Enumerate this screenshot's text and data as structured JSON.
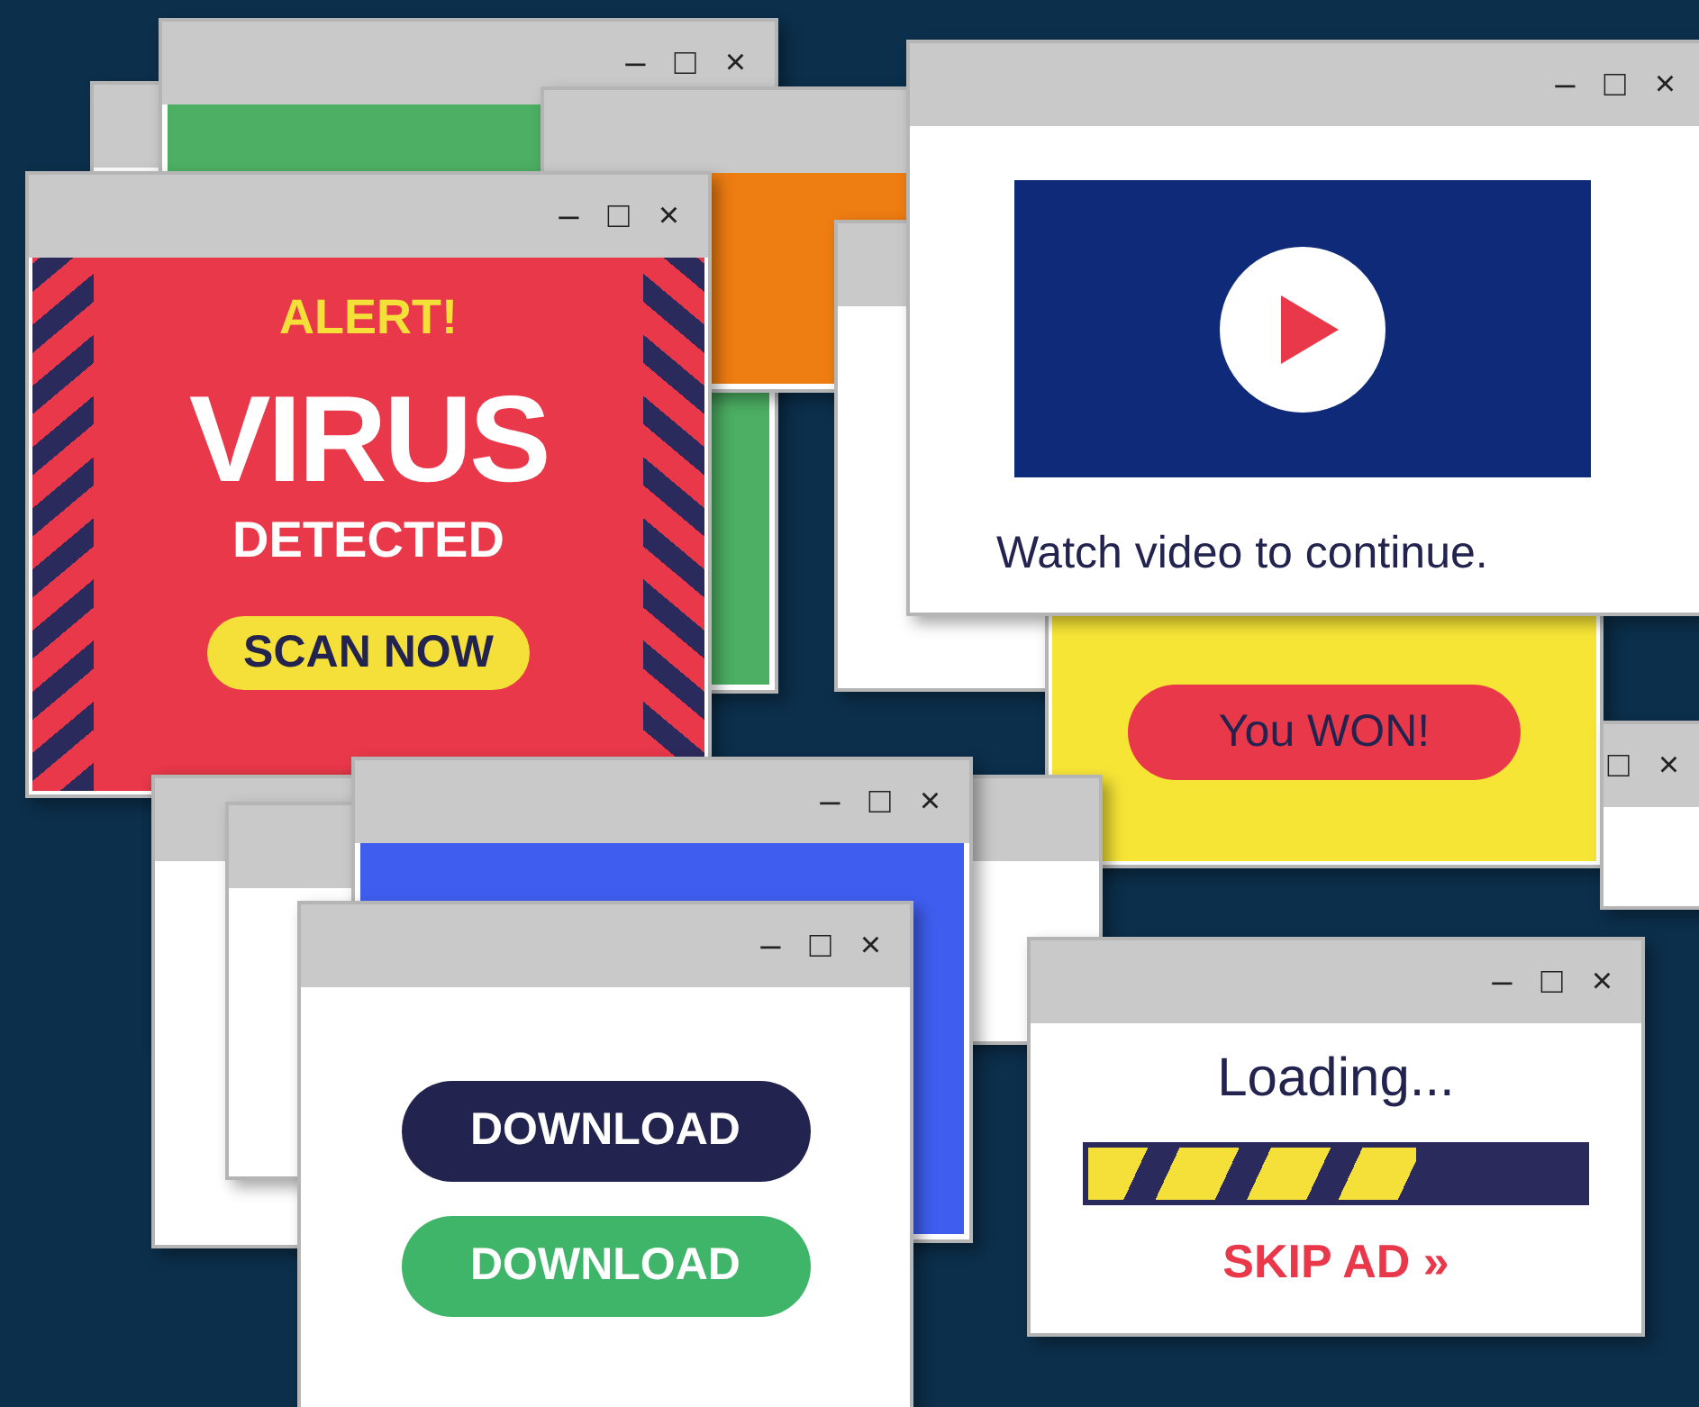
{
  "windows": [
    {
      "kind": "blank"
    },
    {
      "kind": "blank",
      "color": "#4caf63",
      "controls": [
        "–",
        "□",
        "×"
      ]
    },
    {
      "kind": "blank",
      "color": "#ee7d12"
    },
    {
      "kind": "blank"
    },
    {
      "kind": "alert",
      "heading": "ALERT!",
      "title": "VIRUS",
      "subtitle": "DETECTED",
      "button": "SCAN NOW",
      "controls": [
        "–",
        "□",
        "×"
      ]
    },
    {
      "kind": "video",
      "caption": "Watch video to continue.",
      "controls": [
        "–",
        "□",
        "×"
      ]
    },
    {
      "kind": "prize",
      "button": "You WON!"
    },
    {
      "kind": "blank",
      "controls": [
        "□",
        "×"
      ]
    },
    {
      "kind": "blank"
    },
    {
      "kind": "blank"
    },
    {
      "kind": "blank"
    },
    {
      "kind": "blank",
      "color": "#3f5ef0",
      "controls": [
        "–",
        "□",
        "×"
      ]
    },
    {
      "kind": "download",
      "buttons": [
        {
          "label": "DOWNLOAD",
          "color": "#23234f"
        },
        {
          "label": "DOWNLOAD",
          "color": "#3fb56a"
        }
      ],
      "controls": [
        "–",
        "□",
        "×"
      ]
    },
    {
      "kind": "loading",
      "title": "Loading...",
      "level": 0.66,
      "link": "SKIP AD »",
      "controls": [
        "–",
        "□",
        "×"
      ]
    }
  ]
}
